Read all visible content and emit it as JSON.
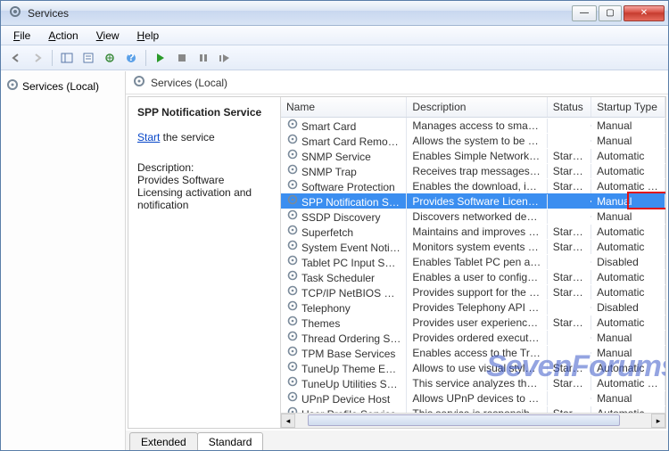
{
  "window": {
    "title": "Services"
  },
  "menus": {
    "file": "File",
    "action": "Action",
    "view": "View",
    "help": "Help"
  },
  "left": {
    "root": "Services (Local)"
  },
  "pane": {
    "header": "Services (Local)",
    "selected_title": "SPP Notification Service",
    "start_link": "Start",
    "start_rest": " the service",
    "desc_label": "Description:",
    "desc_text": "Provides Software Licensing activation and notification"
  },
  "cols": {
    "name": "Name",
    "desc": "Description",
    "status": "Status",
    "startup": "Startup Type"
  },
  "rows": [
    {
      "name": "Smart Card",
      "desc": "Manages access to smart car...",
      "status": "",
      "startup": "Manual",
      "sel": false
    },
    {
      "name": "Smart Card Removal Policy",
      "desc": "Allows the system to be confi...",
      "status": "",
      "startup": "Manual",
      "sel": false
    },
    {
      "name": "SNMP Service",
      "desc": "Enables Simple Network Man...",
      "status": "Started",
      "startup": "Automatic",
      "sel": false
    },
    {
      "name": "SNMP Trap",
      "desc": "Receives trap messages gener...",
      "status": "Started",
      "startup": "Automatic",
      "sel": false
    },
    {
      "name": "Software Protection",
      "desc": "Enables the download, install...",
      "status": "Started",
      "startup": "Automatic (D...",
      "sel": false
    },
    {
      "name": "SPP Notification Service",
      "desc": "Provides Software Licensing a...",
      "status": "",
      "startup": "Manual",
      "sel": true
    },
    {
      "name": "SSDP Discovery",
      "desc": "Discovers networked devices ...",
      "status": "",
      "startup": "Manual",
      "sel": false
    },
    {
      "name": "Superfetch",
      "desc": "Maintains and improves syste...",
      "status": "Started",
      "startup": "Automatic",
      "sel": false
    },
    {
      "name": "System Event Notification Se...",
      "desc": "Monitors system events and ...",
      "status": "Started",
      "startup": "Automatic",
      "sel": false
    },
    {
      "name": "Tablet PC Input Service",
      "desc": "Enables Tablet PC pen and in...",
      "status": "",
      "startup": "Disabled",
      "sel": false
    },
    {
      "name": "Task Scheduler",
      "desc": "Enables a user to configure a...",
      "status": "Started",
      "startup": "Automatic",
      "sel": false
    },
    {
      "name": "TCP/IP NetBIOS Helper",
      "desc": "Provides support for the NetB...",
      "status": "Started",
      "startup": "Automatic",
      "sel": false
    },
    {
      "name": "Telephony",
      "desc": "Provides Telephony API (TAPI...",
      "status": "",
      "startup": "Disabled",
      "sel": false
    },
    {
      "name": "Themes",
      "desc": "Provides user experience the...",
      "status": "Started",
      "startup": "Automatic",
      "sel": false
    },
    {
      "name": "Thread Ordering Server",
      "desc": "Provides ordered execution fo...",
      "status": "",
      "startup": "Manual",
      "sel": false
    },
    {
      "name": "TPM Base Services",
      "desc": "Enables access to the Trusted ...",
      "status": "",
      "startup": "Manual",
      "sel": false
    },
    {
      "name": "TuneUp Theme Extension",
      "desc": "Allows to use visual styles wit...",
      "status": "Started",
      "startup": "Automatic",
      "sel": false
    },
    {
      "name": "TuneUp Utilities Service",
      "desc": "This service analyzes the usag...",
      "status": "Started",
      "startup": "Automatic (D...",
      "sel": false
    },
    {
      "name": "UPnP Device Host",
      "desc": "Allows UPnP devices to be ho...",
      "status": "",
      "startup": "Manual",
      "sel": false
    },
    {
      "name": "User Profile Service",
      "desc": "This service is responsible for ...",
      "status": "Started",
      "startup": "Automatic",
      "sel": false
    }
  ],
  "tabs": {
    "extended": "Extended",
    "standard": "Standard"
  },
  "watermark": "SevenForums"
}
